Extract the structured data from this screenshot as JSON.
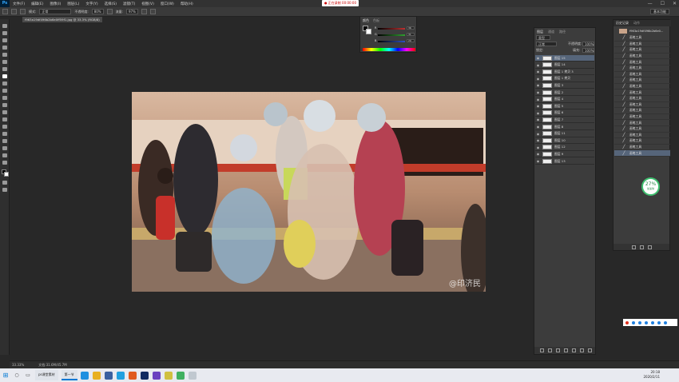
{
  "menubar": {
    "logo": "Ps",
    "items": [
      "文件(F)",
      "编辑(E)",
      "图像(I)",
      "图层(L)",
      "文字(Y)",
      "选择(S)",
      "滤镜(T)",
      "视图(V)",
      "窗口(W)",
      "帮助(H)"
    ],
    "recording": "● 正在录制 00:00:00",
    "window_controls": [
      "—",
      "☐",
      "✕"
    ]
  },
  "options": {
    "mode_label": "模式:",
    "mode_value": "正常",
    "opacity_label": "不透明度:",
    "opacity_value": "80%",
    "flow_label": "流量:",
    "flow_value": "97%",
    "workspace": "基本功能"
  },
  "document": {
    "tab_title": "f963a19df496b2b6e0ff59f1.jpg @ 33.3% (RGB/8)",
    "watermark": "@印济民"
  },
  "color_panel": {
    "tabs": [
      "颜色",
      "色板"
    ],
    "sliders": [
      {
        "label": "R",
        "value": "36",
        "color": "#c03030"
      },
      {
        "label": "G",
        "value": "31",
        "color": "#30a030"
      },
      {
        "label": "B",
        "value": "29",
        "color": "#3050c0"
      }
    ]
  },
  "layers_panel": {
    "tabs": [
      "图层",
      "通道",
      "路径"
    ],
    "kind_label": "类型",
    "blend_value": "正常",
    "opacity_label": "不透明度:",
    "opacity_value": "100%",
    "lock_label": "锁定:",
    "fill_label": "填充:",
    "fill_value": "100%",
    "layers": [
      "图层 15",
      "图层 14",
      "图层 1 拷贝 3",
      "图层 1 拷贝",
      "图层 3",
      "图层 2",
      "图层 4",
      "图层 5",
      "图层 6",
      "图层 7",
      "图层 8",
      "图层 11",
      "图层 10",
      "图层 12",
      "图层 9",
      "图层 13"
    ],
    "selected_index": 0
  },
  "history_panel": {
    "tabs": [
      "历史记录",
      "动作"
    ],
    "snapshot": "f963a19df496b2b6e0...",
    "items": [
      "画笔工具",
      "画笔工具",
      "画笔工具",
      "画笔工具",
      "画笔工具",
      "画笔工具",
      "画笔工具",
      "画笔工具",
      "画笔工具",
      "画笔工具",
      "画笔工具",
      "画笔工具",
      "画笔工具",
      "画笔工具",
      "画笔工具",
      "画笔工具",
      "画笔工具",
      "画笔工具",
      "画笔工具",
      "画笔工具"
    ],
    "selected_index": 19
  },
  "speed_widget": {
    "value": "27%",
    "subtitle": "加速球"
  },
  "statusbar": {
    "zoom": "33.33%",
    "doc_info": "文档:31.6M/45.7M"
  },
  "taskbar": {
    "search_app": "ps课堂素材",
    "active_app": "第一节",
    "time": "20:18",
    "date": "2020/2/11"
  },
  "colors": {
    "selection": "#56657a",
    "panel_bg": "#3c3c3c",
    "canvas_bg": "#282828",
    "accent": "#0078d4"
  }
}
